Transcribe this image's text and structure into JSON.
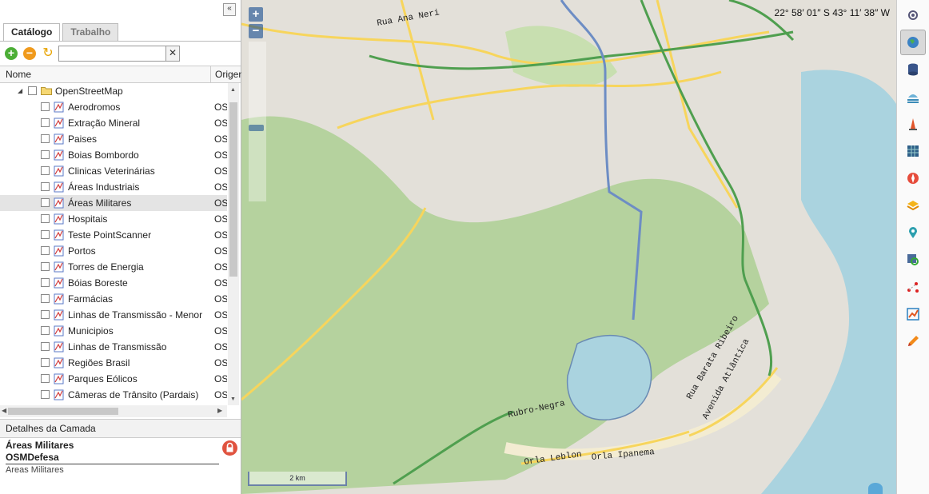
{
  "panel": {
    "collapse_glyph": "«",
    "tabs": [
      {
        "label": "Catálogo",
        "active": true
      },
      {
        "label": "Trabalho",
        "active": false
      }
    ],
    "toolbar": {
      "add_icon": "add-icon",
      "remove_icon": "remove-icon",
      "refresh_icon": "refresh-icon",
      "search_value": "",
      "clear_glyph": "✕"
    },
    "columns": {
      "name": "Nome",
      "origin": "Origem"
    },
    "root": {
      "label": "OpenStreetMap",
      "expanded": true
    },
    "layers": [
      {
        "name": "Aerodromos",
        "origin": "OSM"
      },
      {
        "name": "Extração Mineral",
        "origin": "OSM"
      },
      {
        "name": "Paises",
        "origin": "OSM"
      },
      {
        "name": "Boias Bombordo",
        "origin": "OSM"
      },
      {
        "name": "Clinicas Veterinárias",
        "origin": "OSM"
      },
      {
        "name": "Áreas Industriais",
        "origin": "OSM"
      },
      {
        "name": "Áreas Militares",
        "origin": "OSM",
        "selected": true
      },
      {
        "name": "Hospitais",
        "origin": "OSM"
      },
      {
        "name": "Teste PointScanner",
        "origin": "OSM"
      },
      {
        "name": "Portos",
        "origin": "OSM"
      },
      {
        "name": "Torres de Energia",
        "origin": "OSM"
      },
      {
        "name": "Bóias Boreste",
        "origin": "OSM"
      },
      {
        "name": "Farmácias",
        "origin": "OSM"
      },
      {
        "name": "Linhas de Transmissão - Menor",
        "origin": "OSM"
      },
      {
        "name": "Municipios",
        "origin": "OSM"
      },
      {
        "name": "Linhas de Transmissão",
        "origin": "OSM"
      },
      {
        "name": "Regiões Brasil",
        "origin": "OSM"
      },
      {
        "name": "Parques Eólicos",
        "origin": "OSM"
      },
      {
        "name": "Câmeras de Trânsito (Pardais)",
        "origin": "OSM"
      }
    ],
    "details": {
      "header": "Detalhes da Camada",
      "title": "Áreas Militares",
      "source": "OSMDefesa",
      "description": "Areas Militares",
      "lock_icon": "lock-icon"
    }
  },
  "map": {
    "zoom_in": "+",
    "zoom_out": "−",
    "coordinates": "22° 58′ 01″ S 43° 11′ 38″ W",
    "scale_label": "2 km",
    "street_labels": [
      "Rua Ana Neri",
      "Rubro-Negra",
      "Orla Leblon",
      "Orla Ipanema",
      "Rua Barata Ribeiro",
      "Avenida Atlântica"
    ],
    "colors": {
      "land": "#e3e0d9",
      "forest": "#b5d29e",
      "water": "#aad3df",
      "major_road": "#f7d55c",
      "highway": "#4f9f4f",
      "rail": "#6d8dc4"
    }
  },
  "right_toolbar": {
    "tools": [
      "settings-icon",
      "globe-icon",
      "database-icon",
      "weather-icon",
      "beacon-icon",
      "grid-icon",
      "compass-icon",
      "layers-icon",
      "placemark-icon",
      "search-map-icon",
      "route-icon",
      "chart-icon",
      "pencil-icon"
    ],
    "active_index": 1
  }
}
